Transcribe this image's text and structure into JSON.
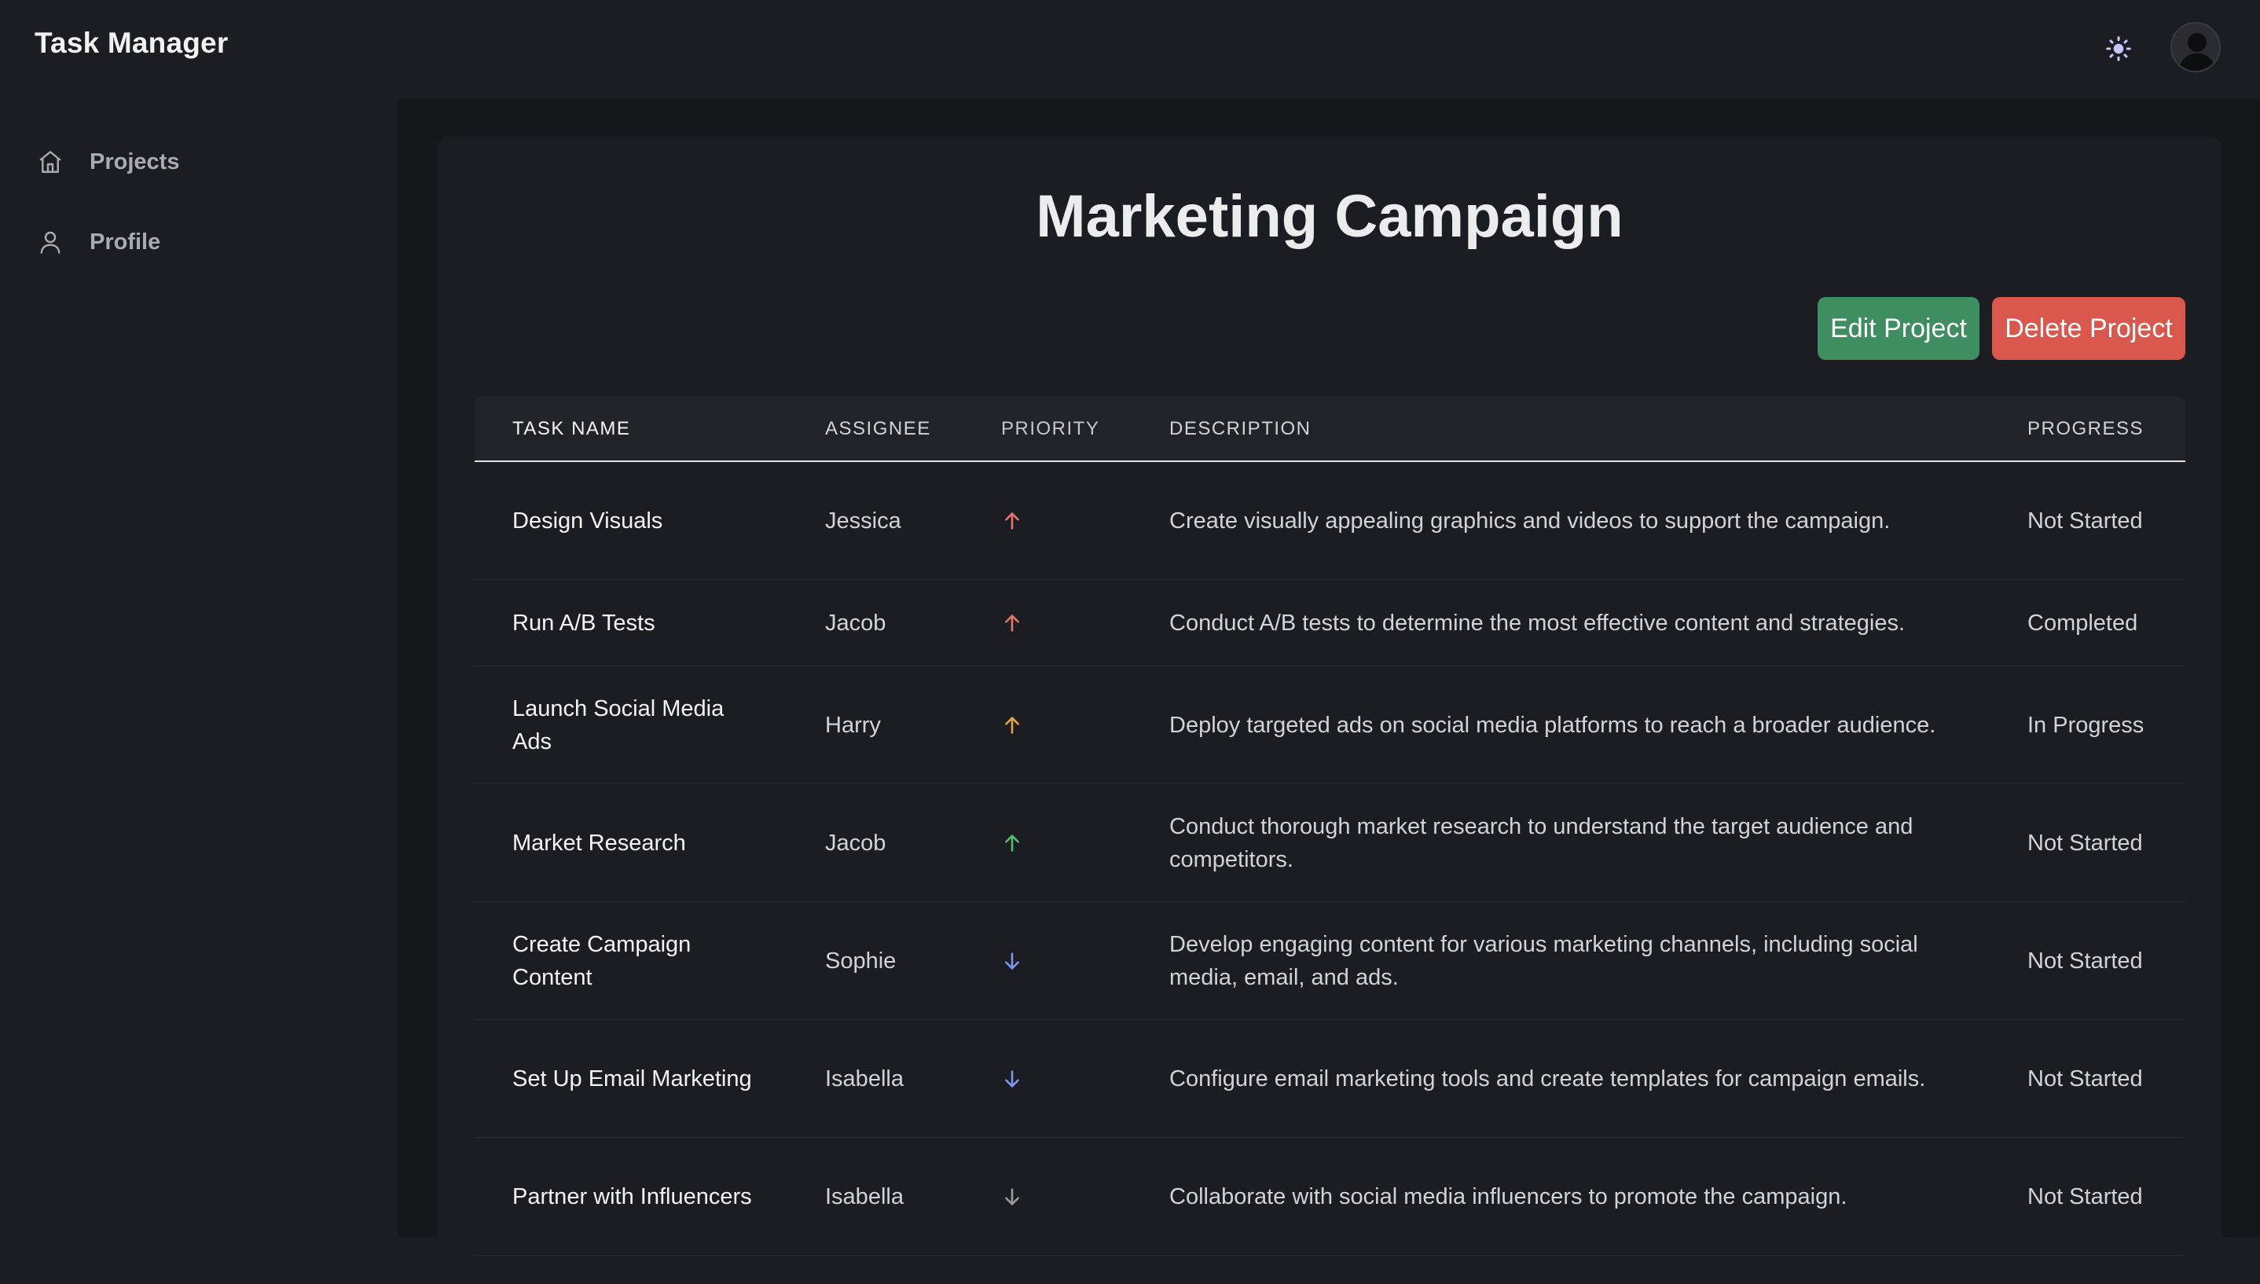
{
  "app": {
    "title": "Task Manager"
  },
  "header": {
    "theme_icon": "sun-icon",
    "avatar_icon": "user-avatar-icon"
  },
  "sidebar": {
    "items": [
      {
        "label": "Projects",
        "icon": "home-icon"
      },
      {
        "label": "Profile",
        "icon": "user-icon"
      }
    ]
  },
  "project": {
    "title": "Marketing Campaign",
    "edit_label": "Edit Project",
    "delete_label": "Delete Project"
  },
  "colors": {
    "edit_button": "#3e8e62",
    "delete_button": "#d9574d",
    "priority_high": "#e8766d",
    "priority_medium": "#e2a83a",
    "priority_low_up": "#4fbf72",
    "priority_low_down": "#7f96f0",
    "priority_lowest": "#9a9ca3"
  },
  "table": {
    "headers": {
      "name": "TASK NAME",
      "assignee": "ASSIGNEE",
      "priority": "PRIORITY",
      "description": "DESCRIPTION",
      "progress": "PROGRESS"
    },
    "rows": [
      {
        "name": "Design Visuals",
        "assignee": "Jessica",
        "priority_icon": "arrow-up-icon",
        "priority_color": "#e8766d",
        "description": "Create visually appealing graphics and videos to support the campaign.",
        "progress": "Not Started"
      },
      {
        "name": "Run A/B Tests",
        "assignee": "Jacob",
        "priority_icon": "arrow-up-icon",
        "priority_color": "#e8766d",
        "description": "Conduct A/B tests to determine the most effective content and strategies.",
        "progress": "Completed"
      },
      {
        "name": "Launch Social Media Ads",
        "assignee": "Harry",
        "priority_icon": "arrow-up-icon",
        "priority_color": "#e2a83a",
        "description": "Deploy targeted ads on social media platforms to reach a broader audience.",
        "progress": "In Progress"
      },
      {
        "name": "Market Research",
        "assignee": "Jacob",
        "priority_icon": "arrow-up-icon",
        "priority_color": "#4fbf72",
        "description": "Conduct thorough market research to understand the target audience and competitors.",
        "progress": "Not Started"
      },
      {
        "name": "Create Campaign Content",
        "assignee": "Sophie",
        "priority_icon": "arrow-down-icon",
        "priority_color": "#7f96f0",
        "description": "Develop engaging content for various marketing channels, including social media, email, and ads.",
        "progress": "Not Started"
      },
      {
        "name": "Set Up Email Marketing",
        "assignee": "Isabella",
        "priority_icon": "arrow-down-icon",
        "priority_color": "#7f96f0",
        "description": "Configure email marketing tools and create templates for campaign emails.",
        "progress": "Not Started"
      },
      {
        "name": "Partner with Influencers",
        "assignee": "Isabella",
        "priority_icon": "arrow-down-icon",
        "priority_color": "#9a9ca3",
        "description": "Collaborate with social media influencers to promote the campaign.",
        "progress": "Not Started"
      }
    ]
  }
}
